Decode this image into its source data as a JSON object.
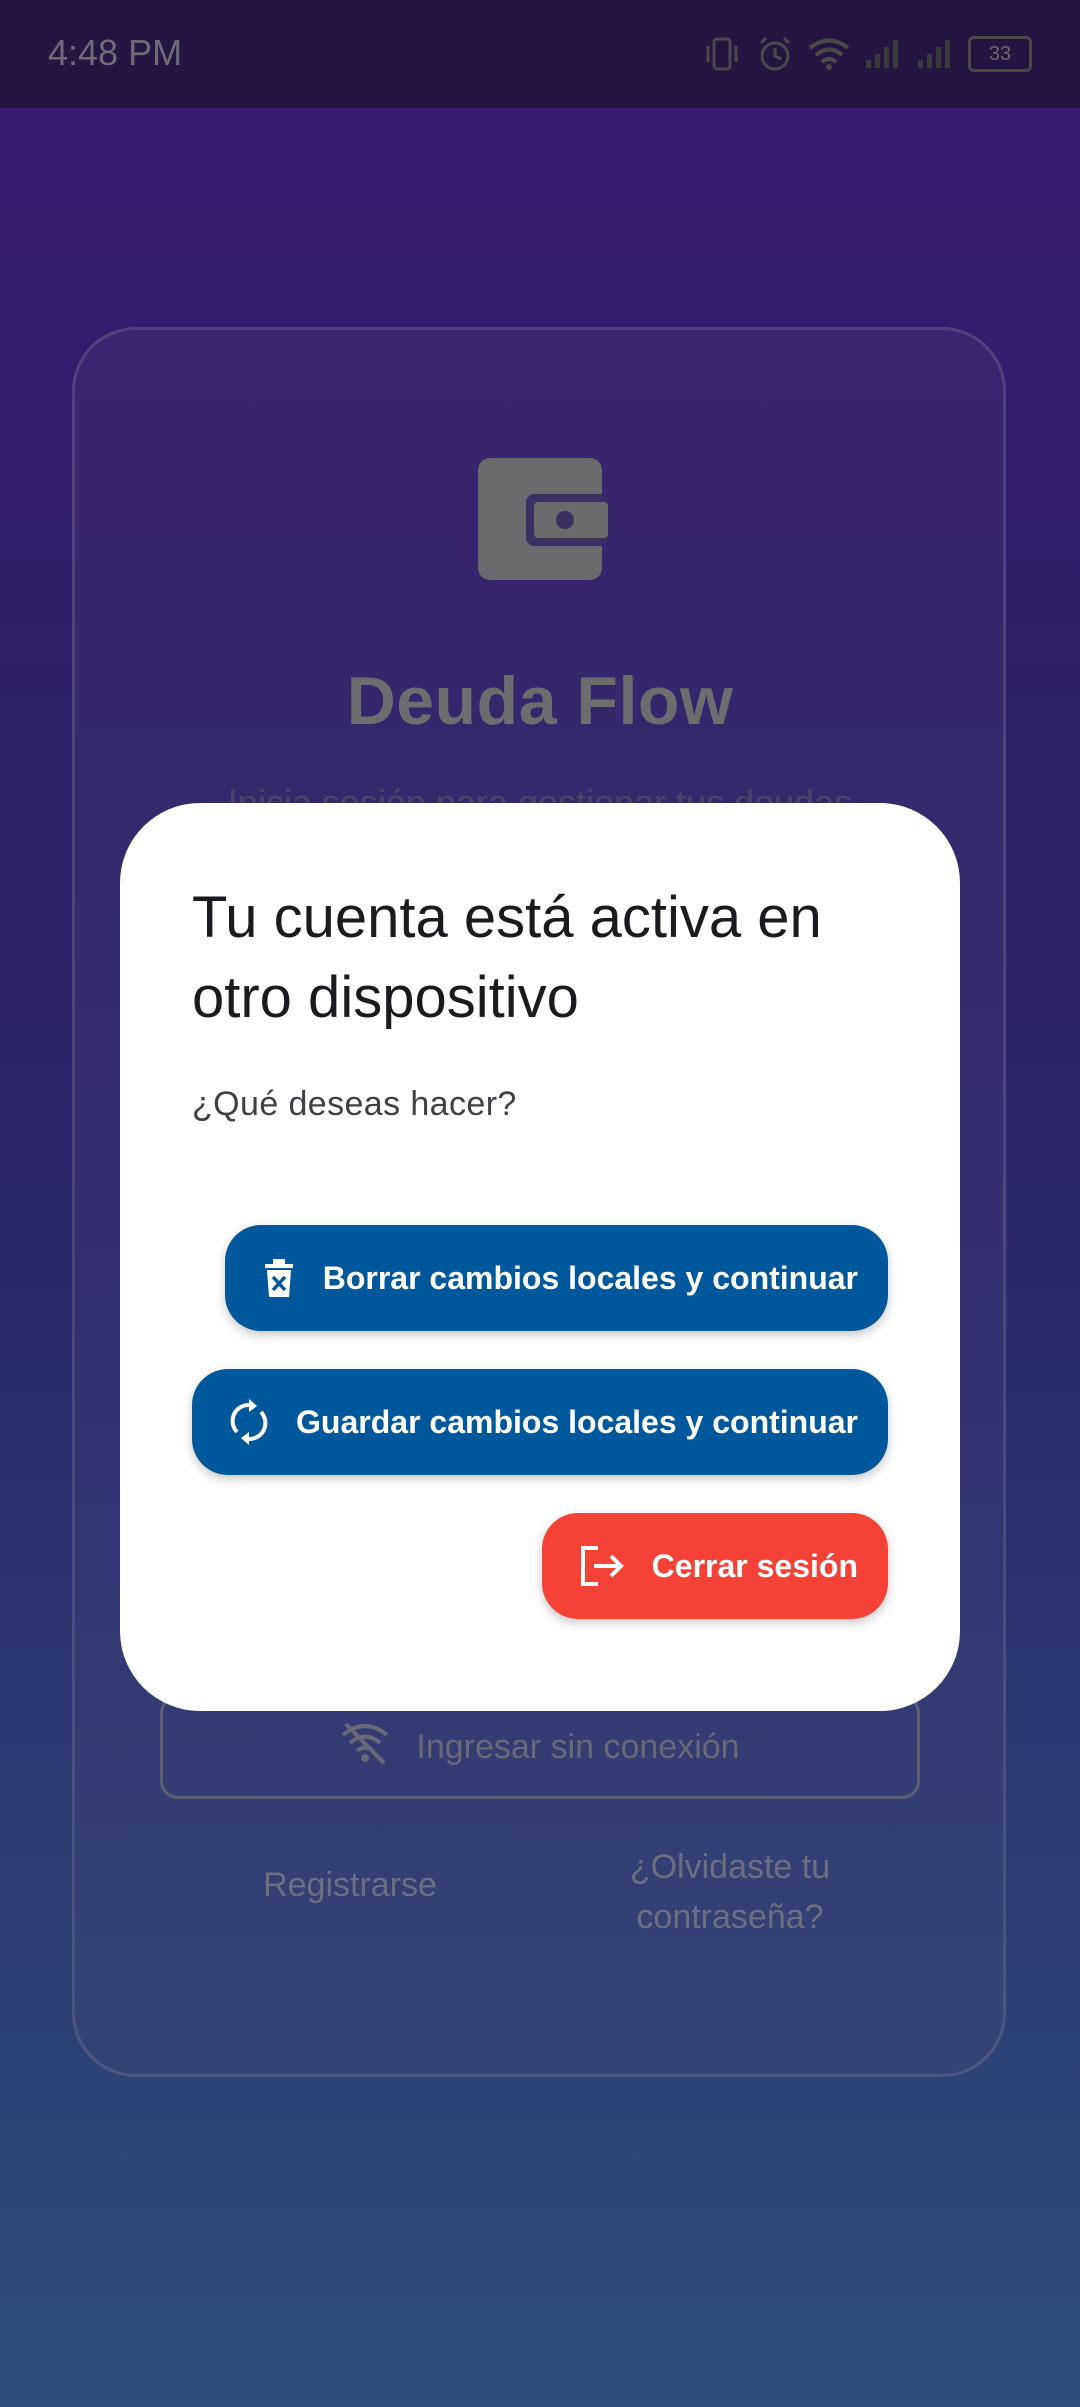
{
  "status_bar": {
    "time": "4:48 PM",
    "battery": "33"
  },
  "login": {
    "app_name": "Deuda Flow",
    "subtitle": "Inicia sesión para gestionar tus deudas",
    "offline_button": "Ingresar sin conexión",
    "register_link": "Registrarse",
    "forgot_link": "¿Olvidaste tu contraseña?"
  },
  "dialog": {
    "title": "Tu cuenta está activa en otro dispositivo",
    "body": "¿Qué deseas hacer?",
    "actions": [
      {
        "label": "Borrar cambios locales y continuar",
        "icon": "delete-icon",
        "color": "#00579a"
      },
      {
        "label": "Guardar cambios locales y continuar",
        "icon": "sync-icon",
        "color": "#00579a"
      },
      {
        "label": "Cerrar sesión",
        "icon": "logout-icon",
        "color": "#f44336"
      }
    ]
  }
}
